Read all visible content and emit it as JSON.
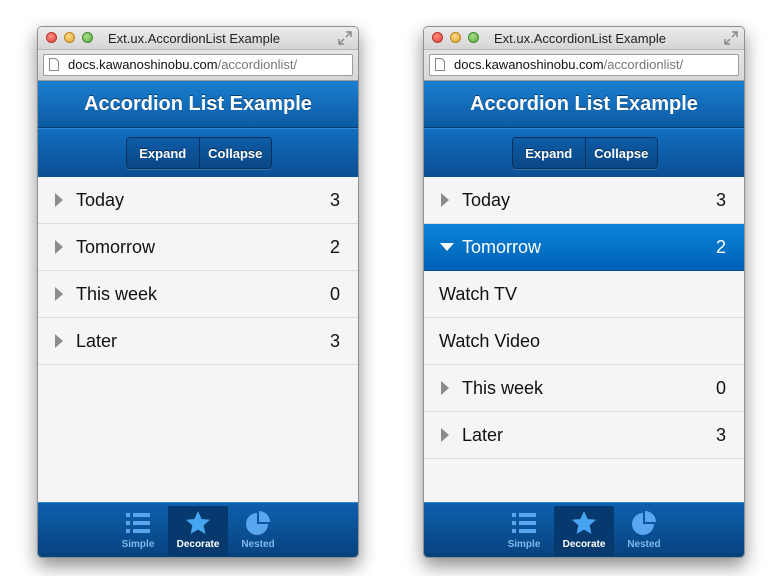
{
  "windows": [
    {
      "title": "Ext.ux.AccordionList Example",
      "url_host": "docs.kawanoshinobu.com",
      "url_path": "/accordionlist/",
      "header_title": "Accordion List Example",
      "buttons": {
        "expand": "Expand",
        "collapse": "Collapse"
      },
      "rows": [
        {
          "label": "Today",
          "count": "3"
        },
        {
          "label": "Tomorrow",
          "count": "2"
        },
        {
          "label": "This week",
          "count": "0"
        },
        {
          "label": "Later",
          "count": "3"
        }
      ],
      "tabs": [
        {
          "label": "Simple",
          "icon": "list-icon"
        },
        {
          "label": "Decorate",
          "icon": "star-icon"
        },
        {
          "label": "Nested",
          "icon": "pie-chart-icon"
        }
      ]
    },
    {
      "title": "Ext.ux.AccordionList Example",
      "url_host": "docs.kawanoshinobu.com",
      "url_path": "/accordionlist/",
      "header_title": "Accordion List Example",
      "buttons": {
        "expand": "Expand",
        "collapse": "Collapse"
      },
      "rows": [
        {
          "label": "Today",
          "count": "3"
        },
        {
          "label": "Tomorrow",
          "count": "2"
        },
        {
          "label": "Watch TV"
        },
        {
          "label": "Watch Video"
        },
        {
          "label": "This week",
          "count": "0"
        },
        {
          "label": "Later",
          "count": "3"
        }
      ],
      "tabs": [
        {
          "label": "Simple",
          "icon": "list-icon"
        },
        {
          "label": "Decorate",
          "icon": "star-icon"
        },
        {
          "label": "Nested",
          "icon": "pie-chart-icon"
        }
      ]
    }
  ],
  "colors": {
    "accent_blue": "#0c5aa3",
    "selected_row": "#0a7ad0",
    "tab_inactive_text": "#7fb8ee"
  }
}
